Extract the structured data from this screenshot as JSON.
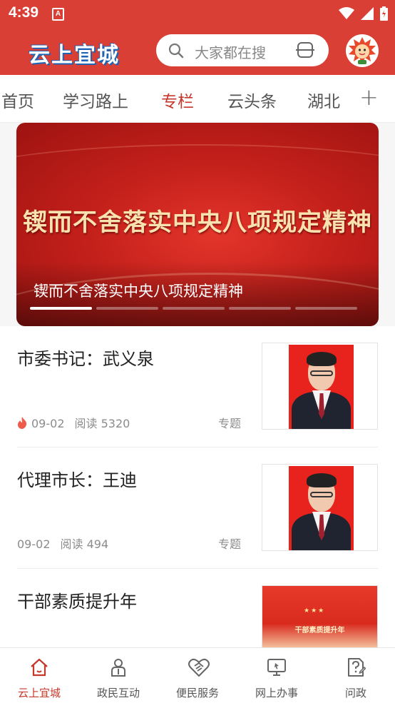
{
  "status_bar": {
    "time": "4:39",
    "notification_badge": "A"
  },
  "header": {
    "logo": "云上宜城",
    "search": {
      "placeholder": "大家都在搜"
    },
    "colors": {
      "brand_red": "#d93f34",
      "active_red": "#c6382c"
    }
  },
  "tabs": [
    {
      "label": "首页",
      "active": false
    },
    {
      "label": "学习路上",
      "active": false
    },
    {
      "label": "专栏",
      "active": true
    },
    {
      "label": "云头条",
      "active": false
    },
    {
      "label": "湖北",
      "active": false
    }
  ],
  "tabs_add": "+",
  "banner": {
    "image_text": "锲而不舍落实中央八项规定精神",
    "caption": "锲而不舍落实中央八项规定精神",
    "slide_count": 5,
    "active_slide": 1
  },
  "news": [
    {
      "title": "市委书记：武义泉",
      "hot": true,
      "date": "09-02",
      "reads": "阅读 5320",
      "tag": "专题",
      "thumb": "portrait"
    },
    {
      "title": "代理市长：王迪",
      "hot": false,
      "date": "09-02",
      "reads": "阅读 494",
      "tag": "专题",
      "thumb": "portrait"
    },
    {
      "title": "干部素质提升年",
      "thumb_text": "干部素质提升年",
      "thumb": "banner"
    }
  ],
  "bottom_nav": [
    {
      "label": "云上宜城",
      "icon": "home-icon",
      "active": true
    },
    {
      "label": "政民互动",
      "icon": "person-icon",
      "active": false
    },
    {
      "label": "便民服务",
      "icon": "heart-handshake-icon",
      "active": false
    },
    {
      "label": "网上办事",
      "icon": "monitor-icon",
      "active": false
    },
    {
      "label": "问政",
      "icon": "question-doc-icon",
      "active": false
    }
  ]
}
